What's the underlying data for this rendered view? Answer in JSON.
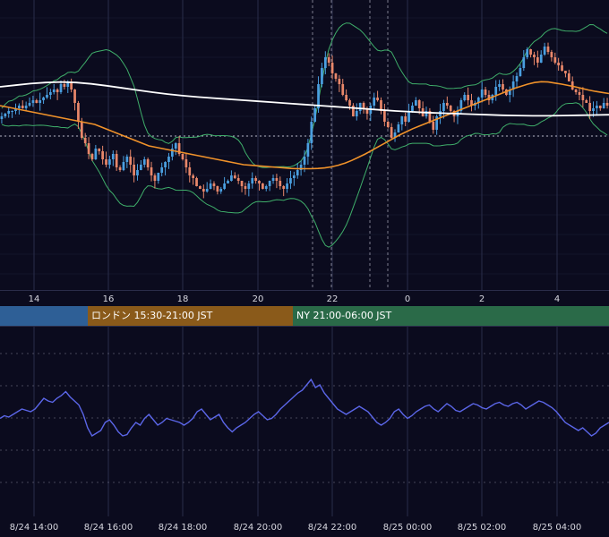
{
  "colors": {
    "background": "#0b0b1e",
    "grid": "#2a2d4a",
    "up_candle": "#4a9fe0",
    "down_candle": "#e8876a",
    "bollinger": "#3fae6a",
    "ma_orange": "#f0922a",
    "ma_white": "#ffffff",
    "oscillator": "#5b66e8",
    "session_tokyo": "#2e5f96",
    "session_london": "#8a5a1a",
    "session_ny": "#2a6a48"
  },
  "upper_time_axis": [
    "14",
    "16",
    "18",
    "20",
    "22",
    "0",
    "2",
    "4"
  ],
  "sessions": [
    {
      "label": ""
    },
    {
      "label": "ロンドン 15:30-21:00 JST"
    },
    {
      "label": "NY 21:00-06:00 JST"
    }
  ],
  "lower_time_axis": [
    "8/24 14:00",
    "8/24 16:00",
    "8/24 18:00",
    "8/24 20:00",
    "8/24 22:00",
    "8/25 00:00",
    "8/25 02:00",
    "8/25 04:00"
  ],
  "chart_data": [
    {
      "type": "candlestick",
      "x_range": [
        "8/24 13:00",
        "8/25 05:30"
      ],
      "y_range": [
        0,
        100
      ],
      "grid": true,
      "series": [
        {
          "name": "",
          "style": "candles"
        },
        {
          "name": "",
          "style": "bollinger-upper"
        },
        {
          "name": "",
          "style": "bollinger-lower"
        },
        {
          "name": "",
          "style": "moving-average-orange"
        },
        {
          "name": "",
          "style": "moving-average-white"
        }
      ],
      "close": [
        60,
        61,
        62,
        62,
        63,
        64,
        63,
        64,
        65,
        66,
        65,
        66,
        67,
        68,
        69,
        70,
        69,
        72,
        71,
        73,
        70,
        65,
        58,
        52,
        50,
        46,
        44,
        48,
        47,
        44,
        42,
        44,
        46,
        41,
        40,
        43,
        45,
        42,
        38,
        40,
        42,
        44,
        41,
        38,
        36,
        39,
        41,
        43,
        45,
        48,
        50,
        46,
        44,
        41,
        38,
        37,
        34,
        33,
        32,
        33,
        35,
        34,
        32,
        33,
        35,
        36,
        38,
        37,
        36,
        34,
        33,
        35,
        37,
        36,
        35,
        33,
        34,
        36,
        37,
        36,
        34,
        33,
        35,
        37,
        38,
        40,
        42,
        45,
        50,
        58,
        63,
        72,
        78,
        82,
        80,
        76,
        74,
        72,
        68,
        66,
        64,
        60,
        62,
        65,
        63,
        61,
        64,
        67,
        66,
        62,
        58,
        56,
        52,
        54,
        57,
        60,
        58,
        62,
        64,
        66,
        63,
        60,
        62,
        58,
        55,
        60,
        62,
        65,
        64,
        62,
        60,
        62,
        66,
        68,
        66,
        64,
        65,
        67,
        70,
        68,
        66,
        68,
        71,
        72,
        70,
        68,
        70,
        73,
        75,
        78,
        82,
        85,
        83,
        82,
        80,
        83,
        86,
        84,
        82,
        80,
        79,
        77,
        76,
        73,
        70,
        69,
        68,
        66,
        65,
        62,
        63,
        64,
        63,
        65,
        64
      ],
      "moving_average_orange": [
        64,
        63.5,
        63,
        62.5,
        62,
        61.5,
        61,
        60.5,
        60,
        59.5,
        59,
        58.5,
        58,
        57.5,
        57,
        56,
        55,
        54,
        53,
        52,
        51,
        50,
        49,
        48.5,
        48,
        47.5,
        47,
        46.5,
        46,
        45.5,
        45,
        44.5,
        44,
        43.5,
        43,
        42.5,
        42,
        41.8,
        41.6,
        41.4,
        41.2,
        41,
        40.8,
        40.6,
        40.5,
        40.5,
        40.5,
        40.6,
        40.8,
        41.2,
        41.8,
        42.6,
        43.6,
        44.8,
        46,
        47.4,
        48.8,
        50.2,
        51.6,
        53,
        54.2,
        55.4,
        56.4,
        57.4,
        58.4,
        59.4,
        60.4,
        61.4,
        62.4,
        63.4,
        64.4,
        65.4,
        66.4,
        67.4,
        68.4,
        69.4,
        70.4,
        71.2,
        72,
        72.6,
        72.9,
        72.8,
        72.4,
        72,
        71.5,
        71,
        70.4,
        69.8,
        69.3,
        68.9,
        68.5
      ],
      "moving_average_white": [
        71,
        71.6,
        72.2,
        72.6,
        72.8,
        72.6,
        72.1,
        71.4,
        70.6,
        69.8,
        69,
        68.3,
        67.7,
        67.2,
        66.8,
        66.4,
        66,
        65.6,
        65.2,
        64.8,
        64.4,
        64,
        63.6,
        63.2,
        62.8,
        62.4,
        62,
        61.7,
        61.4,
        61.2,
        61,
        60.8,
        60.6,
        60.4,
        60.3,
        60.2,
        60.2,
        60.3,
        60.4,
        60.5,
        60.6
      ]
    },
    {
      "type": "line",
      "x_range": [
        "8/24 13:00",
        "8/25 05:30"
      ],
      "y_range": [
        0,
        100
      ],
      "grid": true,
      "series": [
        {
          "name": "",
          "values": [
            45,
            47,
            46,
            48,
            50,
            52,
            51,
            50,
            52,
            56,
            60,
            58,
            57,
            60,
            62,
            65,
            61,
            58,
            55,
            48,
            38,
            32,
            34,
            36,
            42,
            44,
            40,
            35,
            32,
            33,
            38,
            42,
            40,
            45,
            48,
            44,
            40,
            42,
            45,
            44,
            43,
            42,
            40,
            42,
            45,
            50,
            52,
            48,
            44,
            46,
            48,
            42,
            38,
            35,
            38,
            40,
            42,
            45,
            48,
            50,
            47,
            44,
            45,
            48,
            52,
            55,
            58,
            61,
            64,
            66,
            70,
            74,
            68,
            70,
            64,
            60,
            56,
            52,
            50,
            48,
            50,
            52,
            54,
            52,
            50,
            46,
            42,
            40,
            42,
            45,
            50,
            52,
            48,
            45,
            47,
            50,
            52,
            54,
            55,
            52,
            50,
            53,
            56,
            54,
            51,
            50,
            52,
            54,
            56,
            55,
            53,
            52,
            54,
            56,
            57,
            55,
            54,
            56,
            57,
            55,
            52,
            54,
            56,
            58,
            57,
            55,
            53,
            50,
            46,
            42,
            40,
            38,
            36,
            38,
            35,
            32,
            34,
            38,
            40,
            42
          ]
        }
      ]
    }
  ]
}
